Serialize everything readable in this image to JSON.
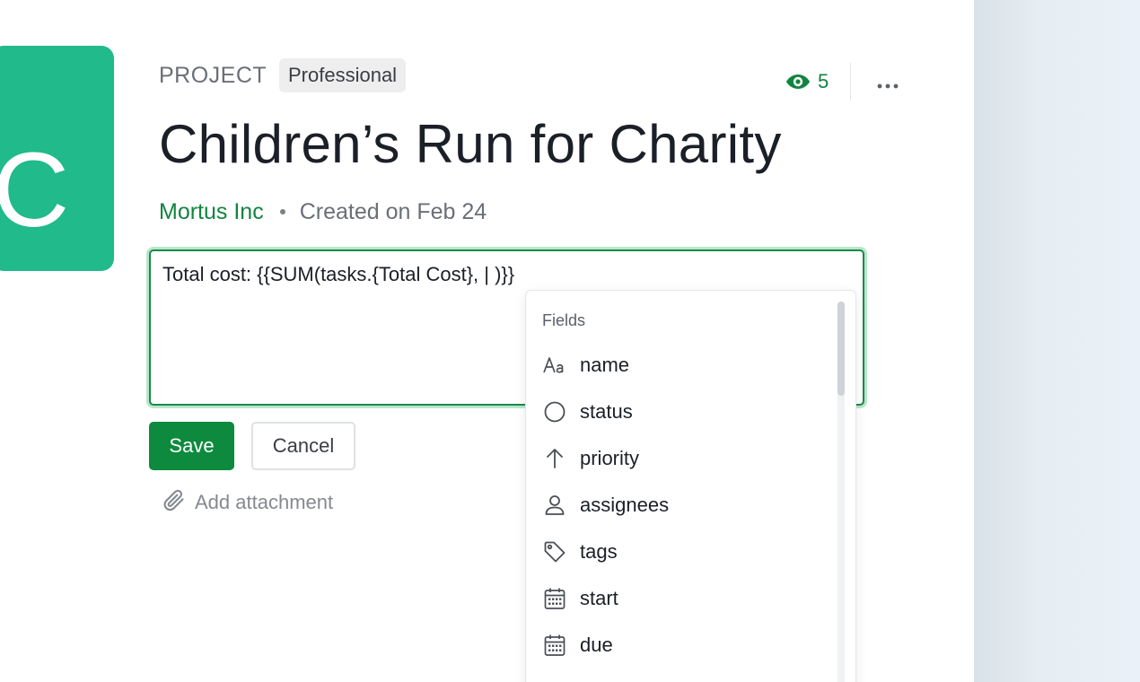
{
  "avatar": {
    "letter": "C",
    "color": "#21ba8a"
  },
  "header": {
    "type_label": "PROJECT",
    "plan_badge": "Professional",
    "watch_count": "5",
    "title": "Children’s Run for Charity",
    "org_name": "Mortus Inc",
    "created_text": "Created on Feb 24"
  },
  "editor": {
    "text": "Total cost: {{SUM(tasks.{Total Cost}, | )}}"
  },
  "actions": {
    "save_label": "Save",
    "cancel_label": "Cancel",
    "attachment_label": "Add attachment"
  },
  "dropdown": {
    "heading": "Fields",
    "items": [
      {
        "label": "name",
        "icon": "text-type-icon"
      },
      {
        "label": "status",
        "icon": "circle-status-icon"
      },
      {
        "label": "priority",
        "icon": "arrow-up-icon"
      },
      {
        "label": "assignees",
        "icon": "person-icon"
      },
      {
        "label": "tags",
        "icon": "tag-icon"
      },
      {
        "label": "start",
        "icon": "calendar-icon"
      },
      {
        "label": "due",
        "icon": "calendar-icon"
      }
    ]
  },
  "colors": {
    "accent_green": "#11843f",
    "save_button": "#0d8a3e",
    "editor_border": "#1b8a48"
  }
}
